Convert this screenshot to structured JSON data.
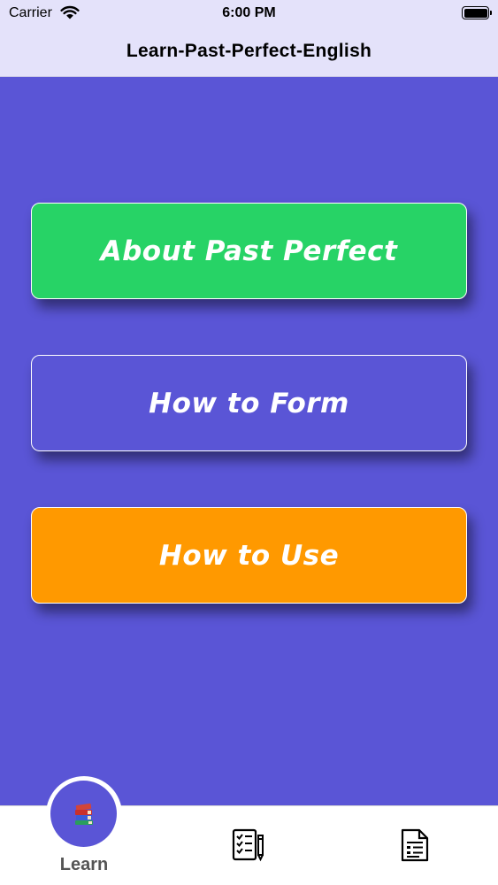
{
  "status_bar": {
    "carrier": "Carrier",
    "time": "6:00 PM",
    "wifi_icon": "wifi-icon",
    "battery_icon": "battery-icon",
    "battery_level": 1.0
  },
  "nav": {
    "title": "Learn-Past-Perfect-English"
  },
  "menu": {
    "about_label": "About Past Perfect",
    "form_label": "How to Form",
    "use_label": "How to Use"
  },
  "tab_bar": {
    "learn_label": "Learn",
    "learn_icon": "books-icon",
    "quiz_icon": "checklist-pencil-icon",
    "notes_icon": "document-list-icon"
  },
  "colors": {
    "background": "#5a55d6",
    "header": "#e4e2fa",
    "about_button": "#27d366",
    "form_button": "#5a55d6",
    "use_button": "#ff9900",
    "tab_label": "#555555"
  }
}
